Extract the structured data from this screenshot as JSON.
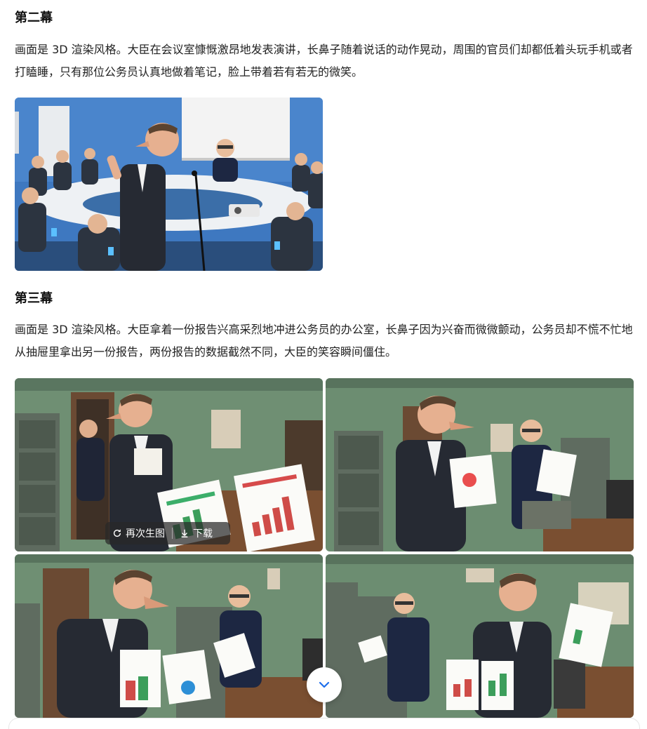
{
  "sections": [
    {
      "title": "第二幕",
      "description": "画面是 3D 渲染风格。大臣在会议室慷慨激昂地发表演讲，长鼻子随着说话的动作晃动，周围的官员们却都低着头玩手机或者打瞌睡，只有那位公务员认真地做着笔记，脸上带着若有若无的微笑。"
    },
    {
      "title": "第三幕",
      "description": "画面是 3D 渲染风格。大臣拿着一份报告兴高采烈地冲进公务员的办公室，长鼻子因为兴奋而微微颤动，公务员却不慌不忙地从抽屉里拿出另一份报告，两份报告的数据截然不同，大臣的笑容瞬间僵住。"
    }
  ],
  "image_toolbar": {
    "regenerate_label": "再次生图",
    "download_label": "下载"
  },
  "icons": {
    "regenerate": "refresh-icon",
    "download": "download-icon",
    "scroll": "chevron-down-icon"
  },
  "colors": {
    "accent": "#1f6feb",
    "meeting_wall": "#3e78c0",
    "office_wall": "#6f8f73",
    "suit": "#2b2f3a"
  }
}
